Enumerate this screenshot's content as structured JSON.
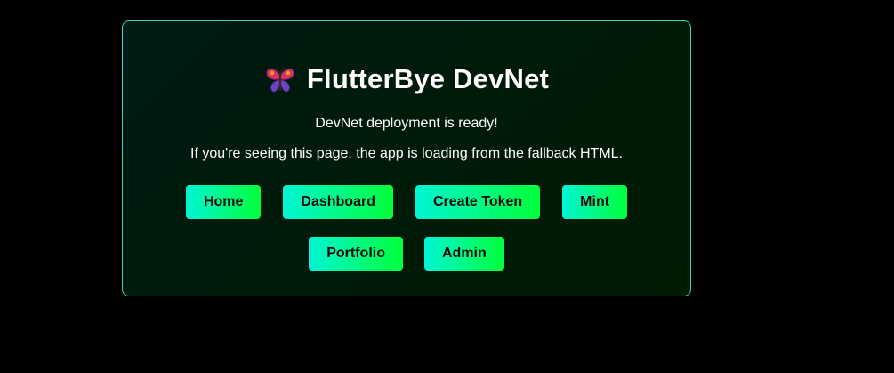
{
  "card": {
    "title": "FlutterBye DevNet",
    "logo_icon": "butterfly-icon",
    "status_message": "DevNet deployment is ready!",
    "fallback_message": "If you're seeing this page, the app is loading from the fallback HTML."
  },
  "nav": {
    "row1": [
      "Home",
      "Dashboard",
      "Create Token",
      "Mint"
    ],
    "row2": [
      "Portfolio",
      "Admin"
    ]
  },
  "colors": {
    "background": "#000000",
    "card_border": "#2fd6c6",
    "button_gradient_start": "#00f5d4",
    "button_gradient_end": "#00ff3a",
    "text": "#ffffff"
  }
}
